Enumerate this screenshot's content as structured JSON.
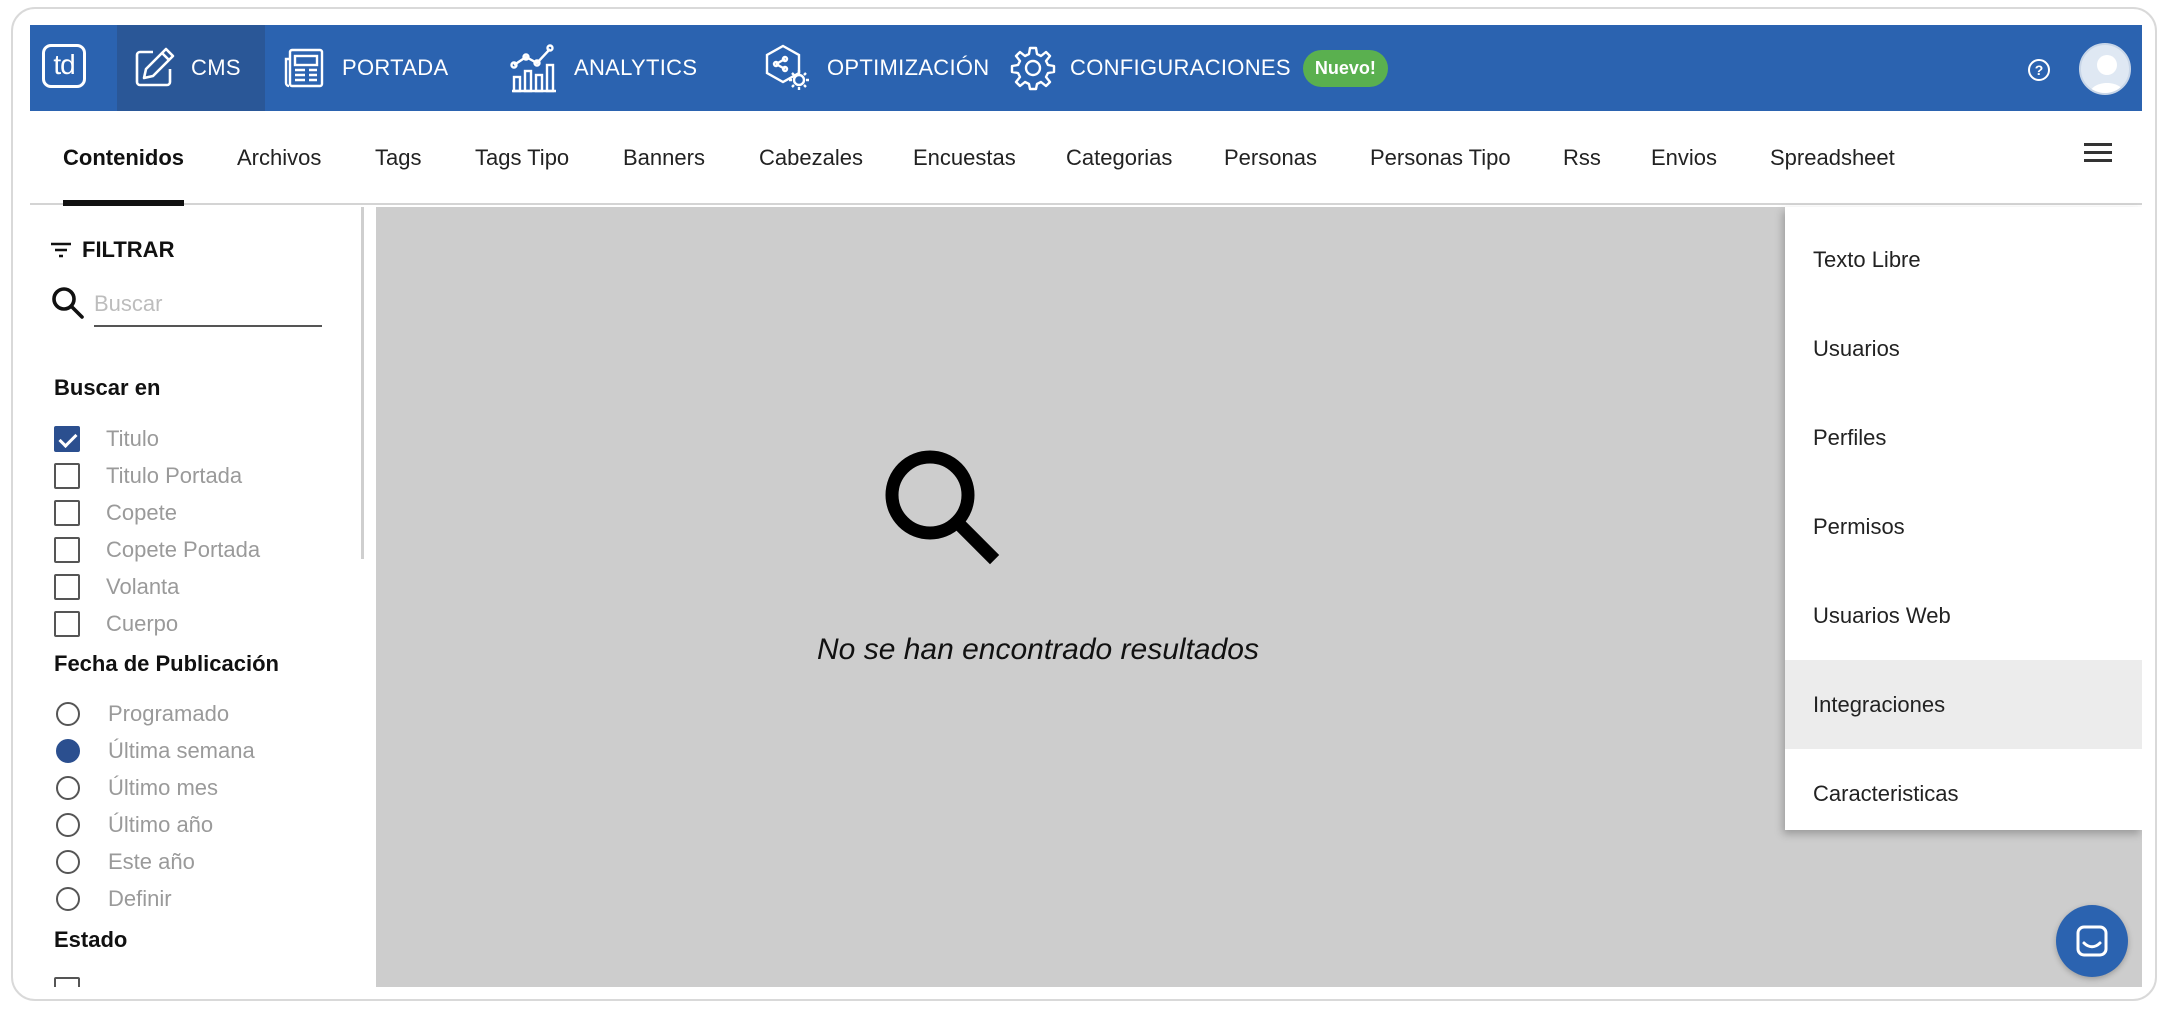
{
  "topbar": {
    "logo": "td",
    "nav": [
      {
        "label": "CMS",
        "icon": "pencil-icon",
        "active": true
      },
      {
        "label": "PORTADA",
        "icon": "newspaper-icon"
      },
      {
        "label": "ANALYTICS",
        "icon": "bar-chart-icon"
      },
      {
        "label": "OPTIMIZACIÓN",
        "icon": "optimization-icon"
      },
      {
        "label": "CONFIGURACIONES",
        "icon": "gear-icon"
      }
    ],
    "badge": "Nuevo!",
    "help": "?"
  },
  "tabs": [
    {
      "label": "Contenidos",
      "active": true
    },
    {
      "label": "Archivos"
    },
    {
      "label": "Tags"
    },
    {
      "label": "Tags Tipo"
    },
    {
      "label": "Banners"
    },
    {
      "label": "Cabezales"
    },
    {
      "label": "Encuestas"
    },
    {
      "label": "Categorias"
    },
    {
      "label": "Personas"
    },
    {
      "label": "Personas Tipo"
    },
    {
      "label": "Rss"
    },
    {
      "label": "Envios"
    },
    {
      "label": "Spreadsheet"
    }
  ],
  "sidebar": {
    "filter_title": "FILTRAR",
    "search_placeholder": "Buscar",
    "search_value": "",
    "buscar_en": {
      "title": "Buscar en",
      "options": [
        {
          "label": "Titulo",
          "checked": true
        },
        {
          "label": "Titulo Portada",
          "checked": false
        },
        {
          "label": "Copete",
          "checked": false
        },
        {
          "label": "Copete Portada",
          "checked": false
        },
        {
          "label": "Volanta",
          "checked": false
        },
        {
          "label": "Cuerpo",
          "checked": false
        }
      ]
    },
    "fecha": {
      "title": "Fecha de Publicación",
      "options": [
        {
          "label": "Programado",
          "checked": false
        },
        {
          "label": "Última semana",
          "checked": true
        },
        {
          "label": "Último mes",
          "checked": false
        },
        {
          "label": "Último año",
          "checked": false
        },
        {
          "label": "Este año",
          "checked": false
        },
        {
          "label": "Definir",
          "checked": false
        }
      ]
    },
    "estado": {
      "title": "Estado"
    }
  },
  "main": {
    "empty_text": "No se han encontrado resultados"
  },
  "menu": {
    "items": [
      {
        "label": "Texto Libre"
      },
      {
        "label": "Usuarios"
      },
      {
        "label": "Perfiles"
      },
      {
        "label": "Permisos"
      },
      {
        "label": "Usuarios Web"
      },
      {
        "label": "Integraciones",
        "hover": true
      },
      {
        "label": "Caracteristicas"
      }
    ]
  },
  "colors": {
    "topbar": "#2b63b0",
    "topbar_active": "#2a5797",
    "badge": "#5ab04f",
    "checked": "#2b4f8f",
    "main_bg": "#cdcdcd"
  }
}
